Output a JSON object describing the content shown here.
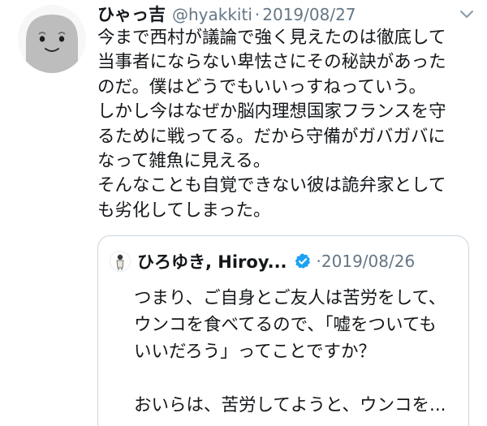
{
  "tweet": {
    "display_name": "ひゃっ吉",
    "handle": "@hyakkiti",
    "separator": "·",
    "date": "2019/08/27",
    "body_lines": [
      "今まで西村が議論で強く見えたのは徹底して",
      "当事者にならない卑怯さにその秘訣があった",
      "のだ。僕はどうでもいいっすねっていう。",
      "しかし今はなぜか脳内理想国家フランスを守",
      "るために戦ってる。だから守備がガバガバに",
      "なって雑魚に見える。",
      "そんなことも自覚できない彼は詭弁家として",
      "も劣化してしまった。"
    ],
    "avatar_icon": "default-face-avatar-icon",
    "menu_icon": "chevron-down-icon"
  },
  "quoted_tweet": {
    "display_name": "ひろゆき, Hiroy...",
    "verified_icon": "verified-badge-icon",
    "date_prefix": "·",
    "date": "2019/08/26",
    "body_lines": [
      "つまり、ご自身とご友人は苦労をして、",
      "ウンコを食べてるので、「嘘をついても",
      "いいだろう」ってことですか？",
      "",
      "おいらは、苦労してようと、ウンコを..."
    ],
    "colors": {
      "verified": "#1da1f2",
      "border": "#ccd6dd"
    }
  },
  "colors": {
    "text": "#14171a",
    "secondary": "#657786"
  }
}
